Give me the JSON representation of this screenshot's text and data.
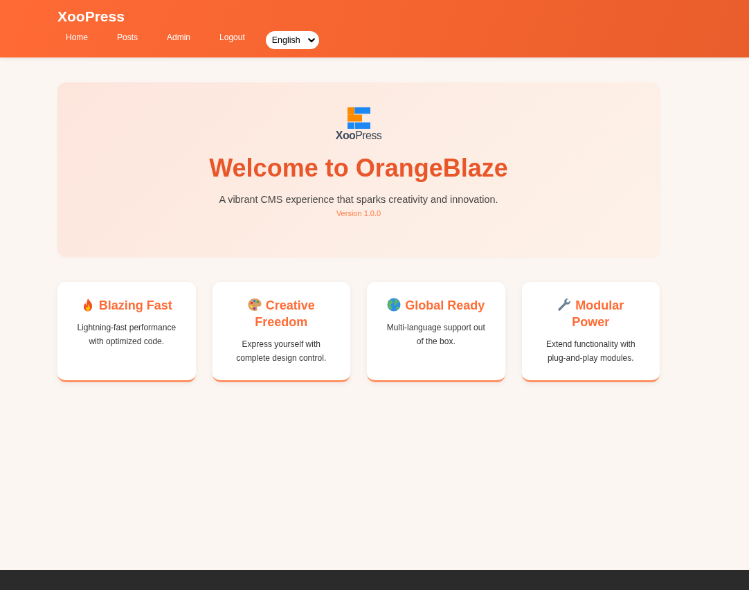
{
  "header": {
    "brand": "XooPress",
    "nav": [
      {
        "label": "Home"
      },
      {
        "label": "Posts"
      },
      {
        "label": "Admin"
      },
      {
        "label": "Logout"
      }
    ],
    "language_select": {
      "value": "English"
    }
  },
  "hero": {
    "logo_text": "**Xoo**Press",
    "title": "Welcome to OrangeBlaze",
    "subtitle": "A vibrant CMS experience that sparks creativity and innovation.",
    "version": "Version 1.0.0"
  },
  "features": [
    {
      "title": "Blazing Fast",
      "description": "Lightning-fast performance with optimized code."
    },
    {
      "title": "Creative Freedom",
      "description": "Express yourself with complete design control."
    },
    {
      "title": "Global Ready",
      "description": "Multi-language support out of the box."
    },
    {
      "title": "Modular Power",
      "description": "Extend functionality with plug-and-play modules."
    }
  ]
}
